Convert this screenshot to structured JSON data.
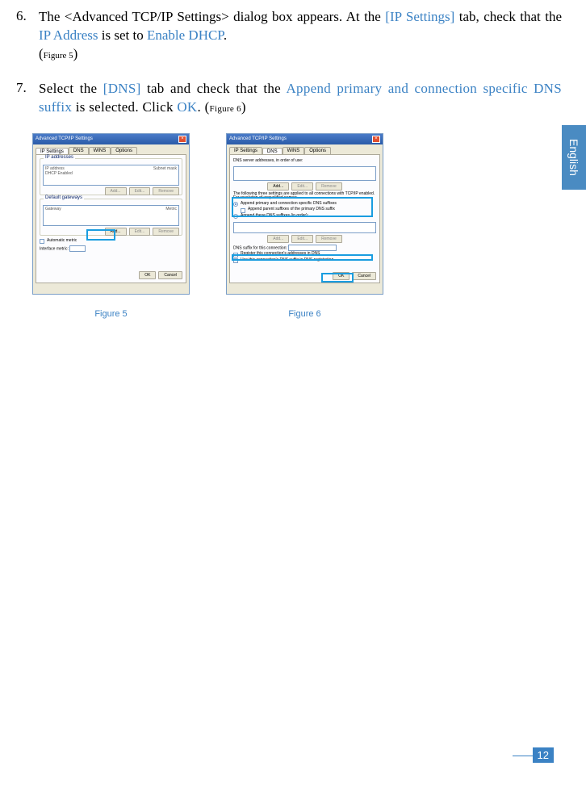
{
  "steps": {
    "s6": {
      "num": "6.",
      "t1": "The <Advanced TCP/IP Settings> dialog box  appears. At the",
      "h1": "[IP Settings]",
      "t2": " tab, check that the ",
      "h2": "IP Address",
      "t3": " is set to ",
      "h3": "Enable DHCP",
      "t4": ".",
      "fig": "Figure 5"
    },
    "s7": {
      "num": "7.",
      "t1": "Select the ",
      "h1": "[DNS]",
      "t2": " tab and check that the ",
      "h2": "Append primary and connection specific DNS suffix",
      "t3": " is selected. Click ",
      "h3": "OK",
      "t4": ". (",
      "fig": "Figure 6",
      "t5": ")"
    }
  },
  "langTab": "English",
  "dialog": {
    "title": "Advanced TCP/IP Settings",
    "tabs": {
      "ip": "IP Settings",
      "dns": "DNS",
      "wins": "WINS",
      "options": "Options"
    },
    "fig5": {
      "group1": "IP addresses",
      "col1": "IP address",
      "col2": "Subnet mask",
      "row1": "DHCP Enabled",
      "group2": "Default gateways",
      "g2col1": "Gateway",
      "g2col2": "Metric",
      "autoMetric": "Automatic metric",
      "metricLabel": "Interface metric:"
    },
    "fig6": {
      "line1": "DNS server addresses, in order of use:",
      "midtext": "The following three settings are applied to all connections with TCP/IP enabled. For resolution of unqualified names:",
      "r1": "Append primary and connection specific DNS suffixes",
      "r1sub": "Append parent suffixes of the primary DNS suffix",
      "r2": "Append these DNS suffixes (in order):",
      "suffixLabel": "DNS suffix for this connection:",
      "chk1": "Register this connection's addresses in DNS",
      "chk2": "Use this connection's DNS suffix in DNS registration"
    },
    "buttons": {
      "add": "Add...",
      "edit": "Edit...",
      "remove": "Remove",
      "ok": "OK",
      "cancel": "Cancel"
    }
  },
  "captions": {
    "f5": "Figure 5",
    "f6": "Figure 6"
  },
  "pageNumber": "12"
}
